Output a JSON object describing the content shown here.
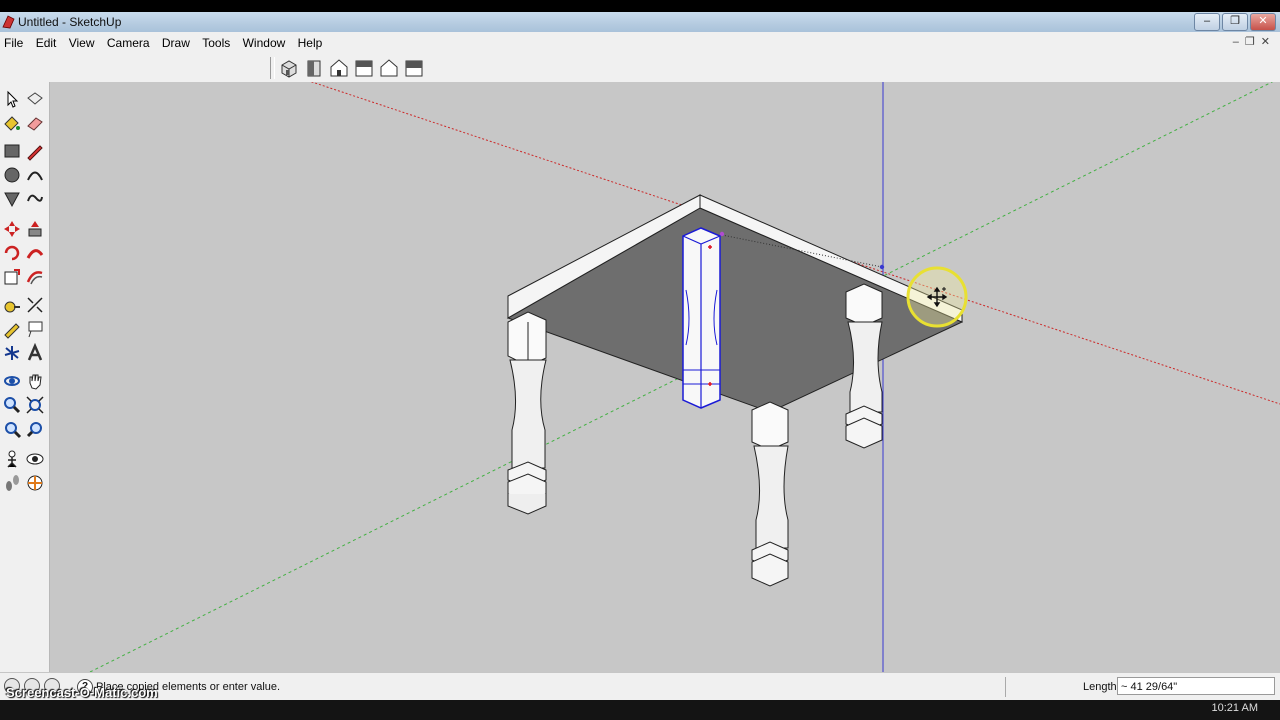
{
  "window": {
    "title": "Untitled - SketchUp",
    "controls": [
      "–",
      "❐",
      "✕"
    ]
  },
  "menu": [
    "File",
    "Edit",
    "View",
    "Camera",
    "Draw",
    "Tools",
    "Window",
    "Help"
  ],
  "views_toolbar": [
    "iso-view-icon",
    "top-view-icon",
    "front-view-icon",
    "right-view-icon",
    "back-view-icon",
    "left-view-icon"
  ],
  "status": {
    "message": "Place copied elements or enter value.",
    "vcb_label": "Length",
    "vcb_value": "~ 41 29/64\""
  },
  "taskbar": {
    "clock": "10:21 AM"
  },
  "watermark": "Screencast-O-Matic.com",
  "colors": {
    "canvas": "#c7c7c7",
    "red_axis": "#cc2a2a",
    "green_axis": "#43b043",
    "blue_axis": "#3a3ad0",
    "selection": "#1a1ad6",
    "cursor_highlight": "#e8e032"
  }
}
